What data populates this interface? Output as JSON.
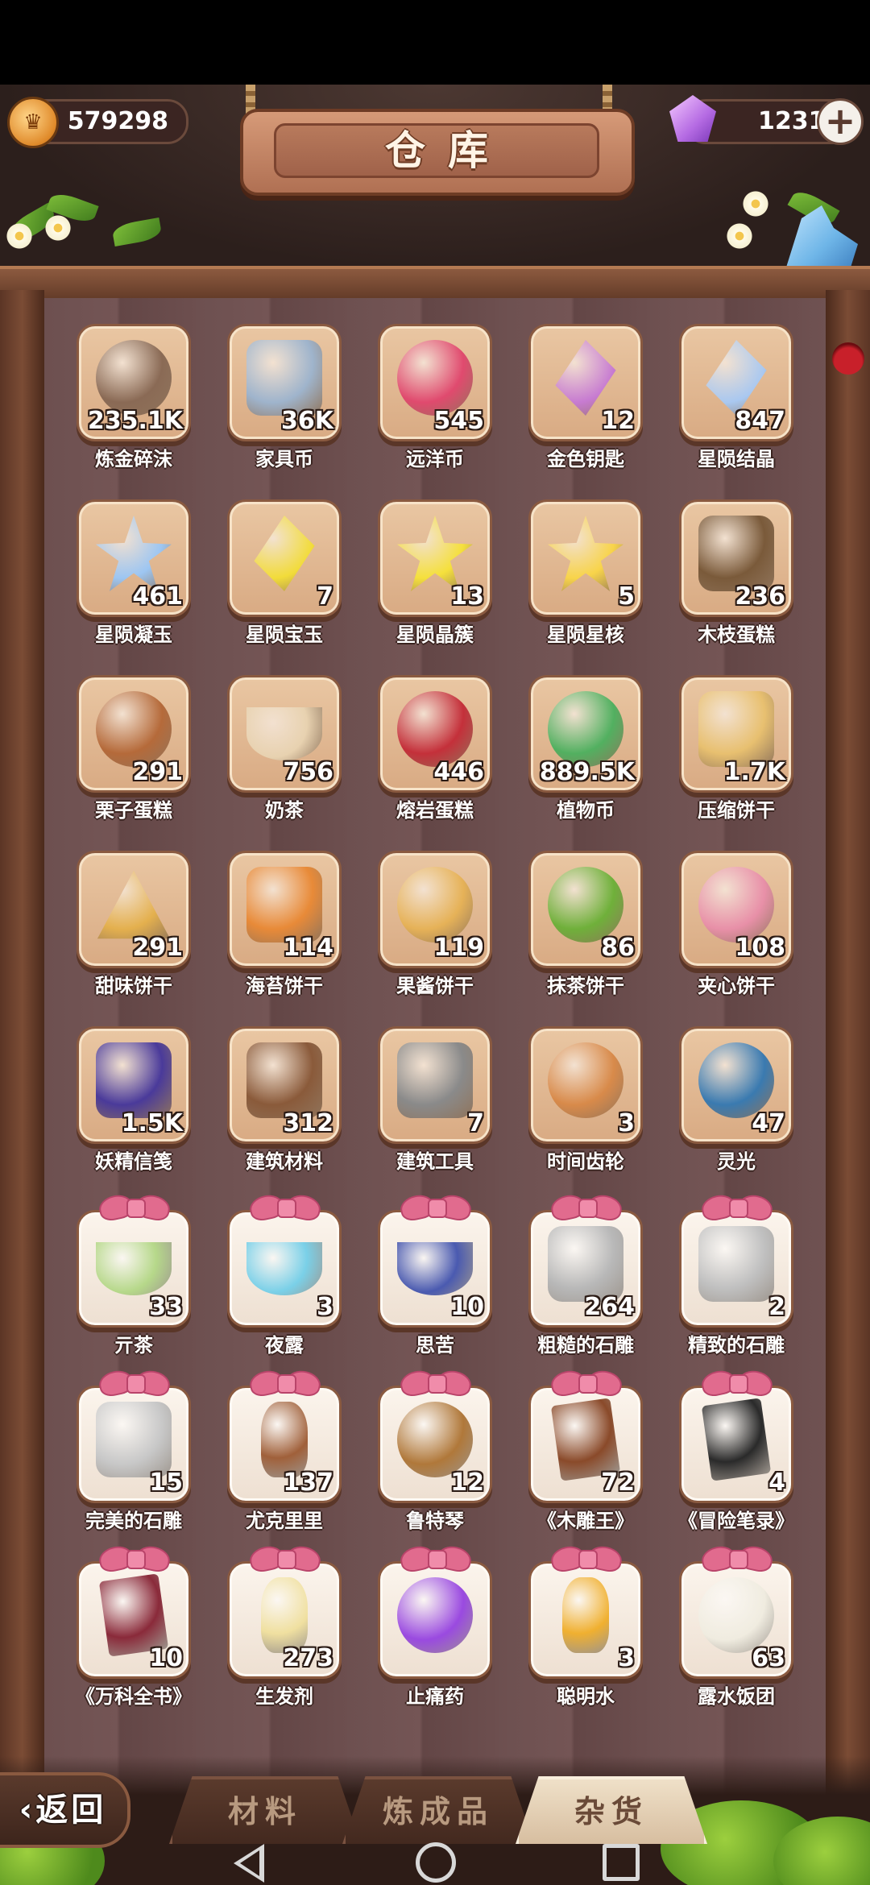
{
  "currency": {
    "gold": "579298",
    "gems": "1231",
    "gold_icon": "crown-coin-icon",
    "gem_icon": "purple-gem-icon",
    "add_icon": "plus-icon"
  },
  "title": "仓库",
  "items": [
    {
      "name": "炼金碎沫",
      "count": "235.1K",
      "color": "#8a6a55",
      "shape": "circle"
    },
    {
      "name": "家具币",
      "count": "36K",
      "color": "#9fb4cc",
      "shape": "sq"
    },
    {
      "name": "远洋币",
      "count": "545",
      "color": "#e04a6e",
      "shape": "circle"
    },
    {
      "name": "金色钥匙",
      "count": "12",
      "color": "#c77bd1",
      "shape": "gem"
    },
    {
      "name": "星陨结晶",
      "count": "847",
      "color": "#a9c8f0",
      "shape": "gem"
    },
    {
      "name": "星陨凝玉",
      "count": "461",
      "color": "#9dc6f2",
      "shape": "star"
    },
    {
      "name": "星陨宝玉",
      "count": "7",
      "color": "#f2dc3a",
      "shape": "gem"
    },
    {
      "name": "星陨晶簇",
      "count": "13",
      "color": "#f5e03c",
      "shape": "star"
    },
    {
      "name": "星陨星核",
      "count": "5",
      "color": "#f8d44a",
      "shape": "star"
    },
    {
      "name": "木枝蛋糕",
      "count": "236",
      "color": "#7a5a3a",
      "shape": "sq"
    },
    {
      "name": "栗子蛋糕",
      "count": "291",
      "color": "#b56a3a",
      "shape": "circle"
    },
    {
      "name": "奶茶",
      "count": "756",
      "color": "#e8d2b0",
      "shape": "cup"
    },
    {
      "name": "熔岩蛋糕",
      "count": "446",
      "color": "#c4303a",
      "shape": "circle"
    },
    {
      "name": "植物币",
      "count": "889.5K",
      "color": "#52b060",
      "shape": "circle"
    },
    {
      "name": "压缩饼干",
      "count": "1.7K",
      "color": "#e8c070",
      "shape": "sq"
    },
    {
      "name": "甜味饼干",
      "count": "291",
      "color": "#e4b04e",
      "shape": "tri"
    },
    {
      "name": "海苔饼干",
      "count": "114",
      "color": "#e88a38",
      "shape": "sq"
    },
    {
      "name": "果酱饼干",
      "count": "119",
      "color": "#e6b258",
      "shape": "circle"
    },
    {
      "name": "抹茶饼干",
      "count": "86",
      "color": "#6fb03a",
      "shape": "circle"
    },
    {
      "name": "夹心饼干",
      "count": "108",
      "color": "#e890a8",
      "shape": "circle"
    },
    {
      "name": "妖精信笺",
      "count": "1.5K",
      "color": "#4a3a9a",
      "shape": "sq"
    },
    {
      "name": "建筑材料",
      "count": "312",
      "color": "#8a5a3a",
      "shape": "sq"
    },
    {
      "name": "建筑工具",
      "count": "7",
      "color": "#8a8a8a",
      "shape": "sq"
    },
    {
      "name": "时间齿轮",
      "count": "3",
      "color": "#d88a4a",
      "shape": "circle"
    },
    {
      "name": "灵光",
      "count": "47",
      "color": "#3a7ab0",
      "shape": "circle"
    },
    {
      "name": "亓茶",
      "count": "33",
      "color": "#b6d88a",
      "shape": "cup",
      "gift": true
    },
    {
      "name": "夜露",
      "count": "3",
      "color": "#7ad0e8",
      "shape": "cup",
      "gift": true
    },
    {
      "name": "思苦",
      "count": "10",
      "color": "#4a5ab0",
      "shape": "cup",
      "gift": true
    },
    {
      "name": "粗糙的石雕",
      "count": "264",
      "color": "#b8b8b8",
      "shape": "sq",
      "gift": true
    },
    {
      "name": "精致的石雕",
      "count": "2",
      "color": "#c0c0c0",
      "shape": "sq",
      "gift": true
    },
    {
      "name": "完美的石雕",
      "count": "15",
      "color": "#c8c8c8",
      "shape": "sq",
      "gift": true
    },
    {
      "name": "尤克里里",
      "count": "137",
      "color": "#a0603a",
      "shape": "bottle",
      "gift": true
    },
    {
      "name": "鲁特琴",
      "count": "12",
      "color": "#b0783a",
      "shape": "circle",
      "gift": true
    },
    {
      "name": "《木雕王》",
      "count": "72",
      "color": "#8a4a2a",
      "shape": "book",
      "gift": true
    },
    {
      "name": "《冒险笔录》",
      "count": "4",
      "color": "#2a2a2a",
      "shape": "book",
      "gift": true
    },
    {
      "name": "《万科全书》",
      "count": "10",
      "color": "#8a2a3a",
      "shape": "book",
      "gift": true
    },
    {
      "name": "生发剂",
      "count": "273",
      "color": "#f0e0a0",
      "shape": "bottle",
      "gift": true
    },
    {
      "name": "止痛药",
      "count": "",
      "color": "#9a4ae0",
      "shape": "circle",
      "gift": true
    },
    {
      "name": "聪明水",
      "count": "3",
      "color": "#f0b030",
      "shape": "bottle",
      "gift": true
    },
    {
      "name": "露水饭团",
      "count": "63",
      "color": "#f0ece0",
      "shape": "circle",
      "gift": true
    }
  ],
  "tabs": [
    {
      "label": "材料",
      "active": false
    },
    {
      "label": "炼成品",
      "active": false
    },
    {
      "label": "杂货",
      "active": true
    }
  ],
  "back_label": "返回",
  "nav": {
    "back_icon": "nav-back-icon",
    "home_icon": "nav-home-icon",
    "recent_icon": "nav-recent-icon"
  }
}
